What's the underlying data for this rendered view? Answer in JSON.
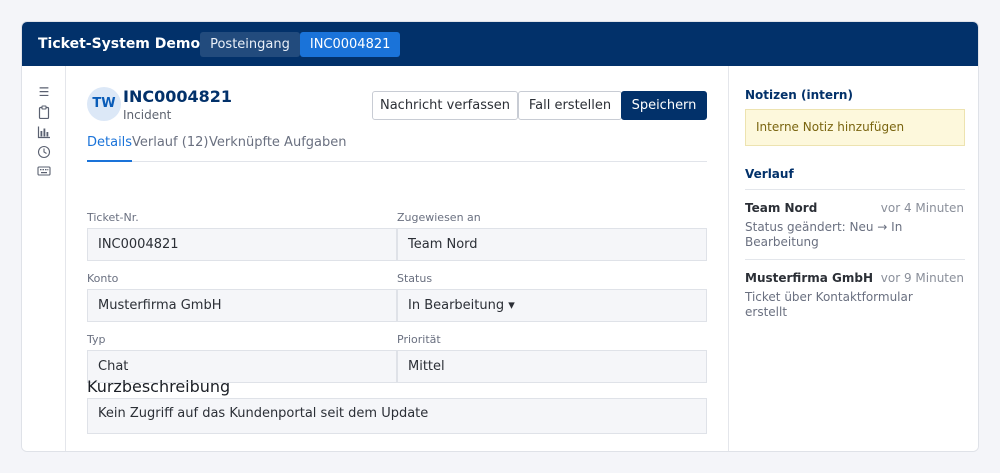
{
  "app": {
    "title": "Ticket-System Demo"
  },
  "nav": {
    "inbox": "Posteingang",
    "current_ticket": "INC0004821"
  },
  "sidebar": {
    "icons": [
      "menu-icon",
      "clipboard-icon",
      "chart-icon",
      "clock-icon",
      "keyboard-icon"
    ],
    "glyphs": [
      "☰",
      "📋",
      "📊",
      "⏲",
      "⌨"
    ]
  },
  "ticket": {
    "avatar": "TW",
    "id": "INC0004821",
    "type": "Incident",
    "buttons": {
      "compose": "Nachricht verfassen",
      "create_case": "Fall erstellen",
      "save": "Speichern"
    },
    "tabs": [
      "Details",
      "Verlauf (12)",
      "Verknüpfte Aufgaben"
    ],
    "fields": {
      "ticket_no": {
        "label": "Ticket-Nr.",
        "value": "INC0004821"
      },
      "assigned": {
        "label": "Zugewiesen an",
        "value": "Team Nord"
      },
      "account": {
        "label": "Konto",
        "value": "Musterfirma GmbH"
      },
      "status": {
        "label": "Status",
        "value": "In Bearbeitung ▾"
      },
      "type": {
        "label": "Typ",
        "value": "Chat"
      },
      "priority": {
        "label": "Priorität",
        "value": "Mittel"
      }
    },
    "summary": {
      "title": "Kurzbeschreibung",
      "value": "Kein Zugriff auf das Kundenportal seit dem Update"
    }
  },
  "right_panel": {
    "notes_title": "Notizen (intern)",
    "note_placeholder": "Interne Notiz hinzufügen",
    "history_title": "Verlauf",
    "history": [
      {
        "name": "Team Nord",
        "time": "vor 4 Minuten",
        "text": "Status geändert: Neu → In Bearbeitung"
      },
      {
        "name": "Musterfirma GmbH",
        "time": "vor 9 Minuten",
        "text": "Ticket über Kontaktformular erstellt"
      }
    ]
  },
  "colors": {
    "brand": "#02316a",
    "accent": "#1a73d9",
    "note_bg": "#fdf8dc"
  }
}
